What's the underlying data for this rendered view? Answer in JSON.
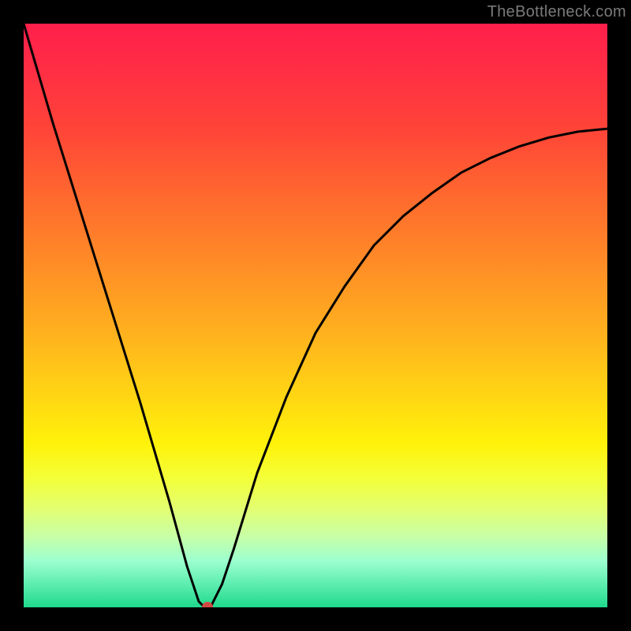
{
  "watermark": "TheBottleneck.com",
  "chart_data": {
    "type": "line",
    "title": "",
    "xlabel": "",
    "ylabel": "",
    "xlim": [
      0,
      100
    ],
    "ylim": [
      0,
      100
    ],
    "grid": false,
    "series": [
      {
        "name": "curve",
        "x": [
          0,
          5,
          10,
          15,
          20,
          25,
          28,
          30,
          31,
          32,
          34,
          36,
          40,
          45,
          50,
          55,
          60,
          65,
          70,
          75,
          80,
          85,
          90,
          95,
          100
        ],
        "values": [
          100,
          83,
          67,
          51,
          35,
          18,
          7,
          1,
          0,
          0,
          4,
          10,
          23,
          36,
          47,
          55,
          62,
          67,
          71,
          74.5,
          77,
          79,
          80.5,
          81.5,
          82
        ]
      }
    ],
    "marker": {
      "x": 31.5,
      "y": 0,
      "color": "#d24a46",
      "radius_px": 7
    },
    "colors": {
      "curve": "#000000",
      "frame": "#000000",
      "gradient_stops": [
        "#ff1f4b",
        "#ff6a2e",
        "#ffd314",
        "#f3ff3a",
        "#1fd98c"
      ]
    }
  }
}
